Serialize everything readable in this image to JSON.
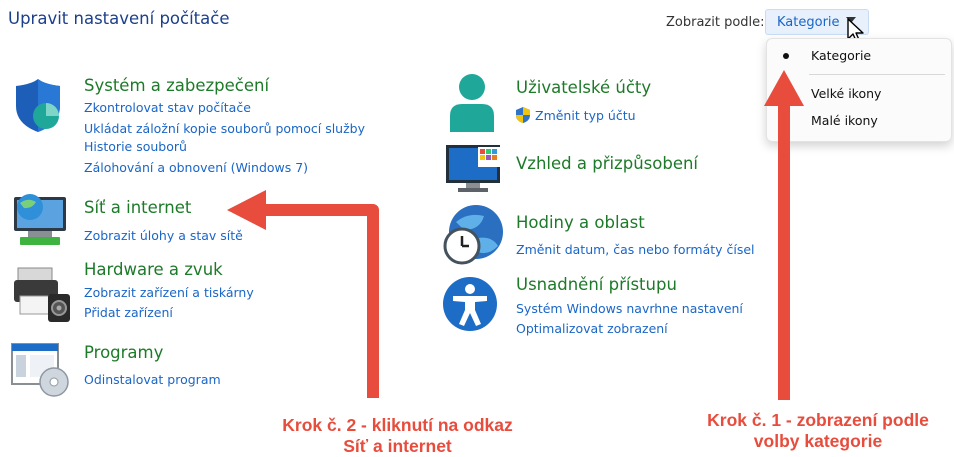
{
  "header": {
    "title": "Upravit nastavení počítače",
    "view_by_label": "Zobrazit podle:",
    "view_by_value": "Kategorie"
  },
  "view_menu": {
    "items": [
      {
        "label": "Kategorie",
        "selected": true
      },
      {
        "label": "Velké ikony",
        "selected": false
      },
      {
        "label": "Malé ikony",
        "selected": false
      }
    ]
  },
  "left_categories": {
    "system": {
      "title": "Systém a zabezpečení",
      "links": [
        "Zkontrolovat stav počítače",
        "Ukládat záložní kopie souborů pomocí služby",
        "Historie souborů",
        "Zálohování a obnovení (Windows 7)"
      ]
    },
    "network": {
      "title": "Síť a internet",
      "links": [
        "Zobrazit úlohy a stav sítě"
      ]
    },
    "hardware": {
      "title": "Hardware a zvuk",
      "links": [
        "Zobrazit zařízení a tiskárny",
        "Přidat zařízení"
      ]
    },
    "programs": {
      "title": "Programy",
      "links": [
        "Odinstalovat program"
      ]
    }
  },
  "right_categories": {
    "accounts": {
      "title": "Uživatelské účty",
      "links": [
        "Změnit typ účtu"
      ]
    },
    "appearance": {
      "title": "Vzhled a přizpůsobení",
      "links": []
    },
    "clock": {
      "title": "Hodiny a oblast",
      "links": [
        "Změnit datum, čas nebo formáty čísel"
      ]
    },
    "access": {
      "title": "Usnadnění přístupu",
      "links": [
        "Systém Windows navrhne nastavení",
        "Optimalizovat zobrazení"
      ]
    }
  },
  "annotations": {
    "step2_line1": "Krok č. 2 - kliknutí na odkaz",
    "step2_line2": "Síť a internet",
    "step1_line1": "Krok č. 1  - zobrazení podle",
    "step1_line2": "volby kategorie"
  },
  "colors": {
    "category_title": "#1c7a28",
    "link": "#1a66c7",
    "page_title": "#1c3f8c",
    "annotation": "#e74c3c"
  }
}
